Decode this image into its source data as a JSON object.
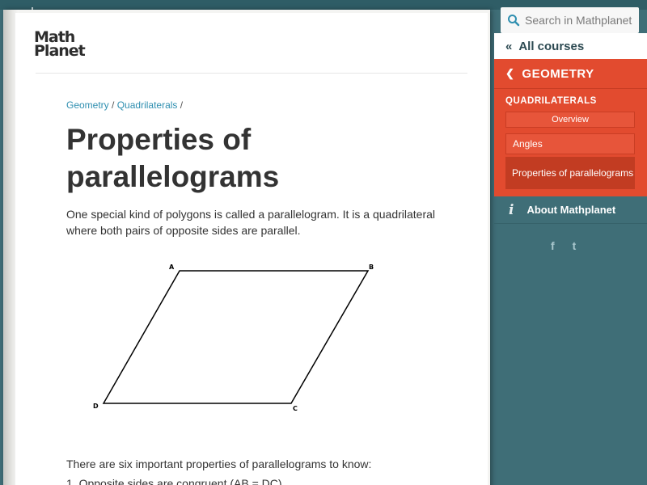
{
  "logo": {
    "line1": "Math",
    "line2": "Planet"
  },
  "breadcrumb": {
    "items": [
      "Geometry",
      "Quadrilaterals"
    ],
    "separator": "/"
  },
  "article": {
    "title": "Properties of parallelograms",
    "intro": "One special kind of polygons is called a parallelogram. It is a quadrilateral where both pairs of opposite sides are parallel.",
    "figure_labels": {
      "a": "A",
      "b": "B",
      "c": "C",
      "d": "D"
    },
    "properties_intro": "There are six important properties of parallelograms to know:",
    "first_property": "1. Opposite sides are congruent (AB = DC)."
  },
  "sidebar": {
    "search_placeholder": "Search in Mathplanet",
    "all_courses": "All courses",
    "course": "GEOMETRY",
    "section": "QUADRILATERALS",
    "overview": "Overview",
    "items": [
      "Angles",
      "Properties of parallelograms"
    ],
    "about": "About Mathplanet",
    "social": {
      "facebook": "f",
      "twitter": "t"
    }
  },
  "colors": {
    "sidebar_bg": "#3f6e77",
    "accent": "#e24b2f",
    "link": "#2f8fb0"
  }
}
